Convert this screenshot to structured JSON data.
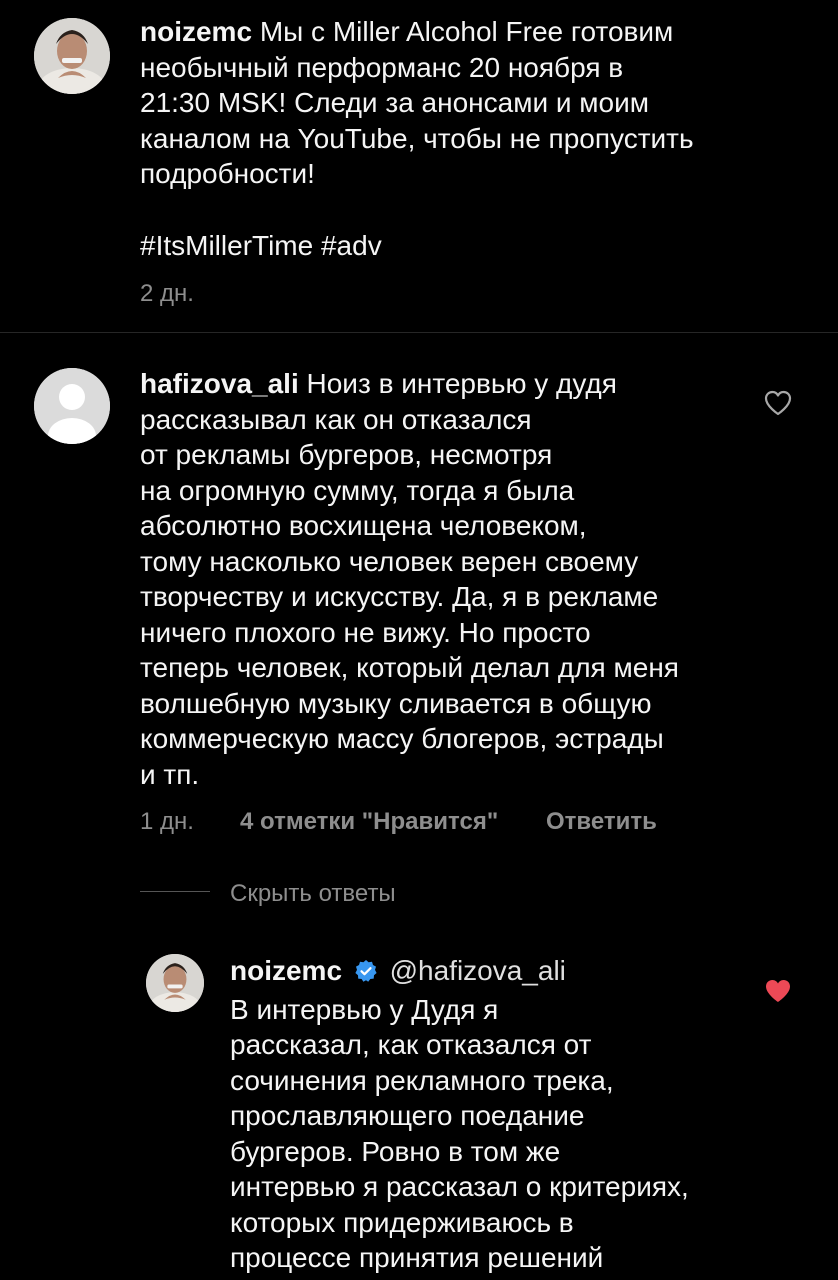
{
  "caption": {
    "username": "noizemc",
    "lines": [
      "Мы с Miller Alcohol Free готовим",
      "необычный перформанс 20 ноября в",
      "21:30 MSK! Следи за анонсами и моим",
      "каналом на YouTube, чтобы не пропустить",
      "подробности!"
    ],
    "hashtags": "#ItsMillerTime #adv",
    "time": "2 дн."
  },
  "comment": {
    "username": "hafizova_ali",
    "lines": [
      "Ноиз в интервью у дудя",
      "рассказывал как он отказался",
      "от рекламы бургеров, несмотря",
      "на огромную сумму, тогда я была",
      "абсолютно восхищена человеком,",
      "тому насколько человек верен своему",
      "творчеству и искусству. Да, я в рекламе",
      "ничего плохого не вижу. Но просто",
      "теперь человек, который делал для меня",
      "волшебную музыку сливается в общую",
      "коммерческую массу блогеров, эстрады",
      "и тп."
    ],
    "time": "1 дн.",
    "likes": "4 отметки \"Нравится\"",
    "reply": "Ответить",
    "hide_replies": "Скрыть ответы"
  },
  "reply": {
    "username": "noizemc",
    "mention": "@hafizova_ali",
    "lines": [
      "В интервью у Дудя я",
      "рассказал, как отказался от",
      "сочинения рекламного трека,",
      "прославляющего поедание",
      "бургеров. Ровно в том же",
      "интервью я рассказал о критериях,",
      "которых придерживаюсь в",
      "процессе принятия решений"
    ]
  },
  "colors": {
    "background": "#000000",
    "text": "#f5f5f5",
    "muted": "#8e8e8e",
    "like_red": "#ed4956",
    "verified_blue": "#3897f0"
  }
}
